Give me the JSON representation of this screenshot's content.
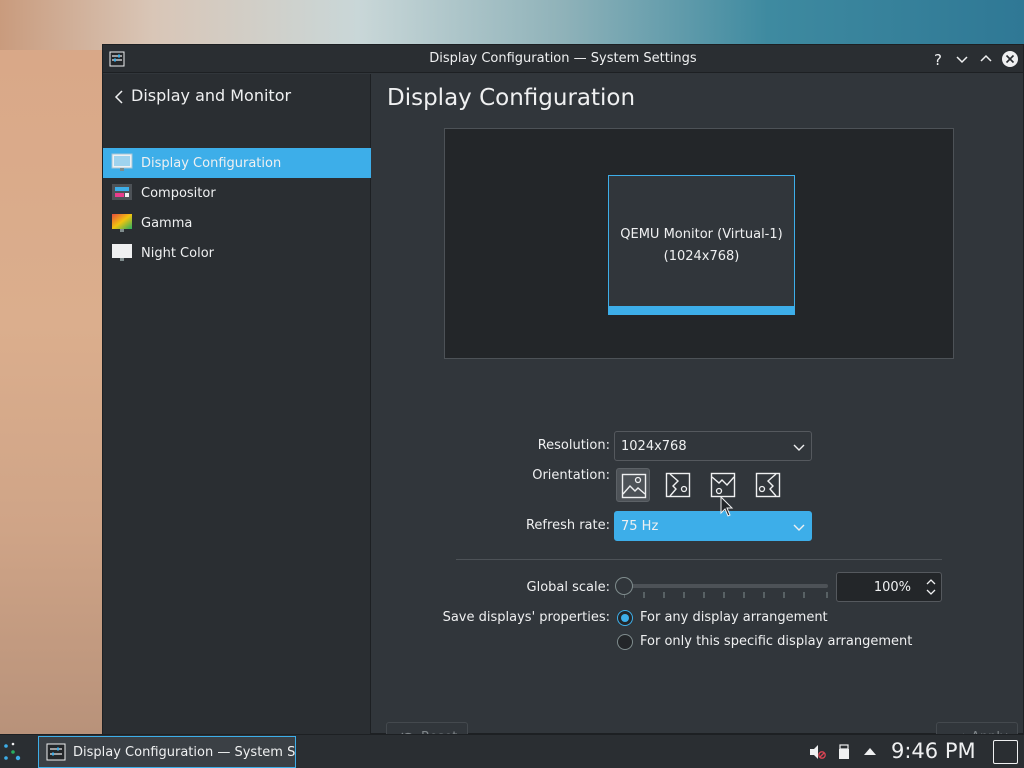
{
  "window": {
    "title": "Display Configuration — System Settings"
  },
  "sidebar": {
    "header": "Display and Monitor",
    "items": [
      {
        "label": "Display Configuration",
        "icon": "monitor-icon",
        "active": true
      },
      {
        "label": "Compositor",
        "icon": "compositor-icon",
        "active": false
      },
      {
        "label": "Gamma",
        "icon": "gamma-icon",
        "active": false
      },
      {
        "label": "Night Color",
        "icon": "night-color-icon",
        "active": false
      }
    ]
  },
  "main": {
    "title": "Display Configuration",
    "monitor": {
      "name": "QEMU Monitor (Virtual-1)",
      "resolution_label": "(1024x768)"
    },
    "resolution": {
      "label": "Resolution:",
      "value": "1024x768"
    },
    "orientation": {
      "label": "Orientation:",
      "options": [
        "landscape",
        "portrait-left",
        "inverted",
        "portrait-right"
      ],
      "selected": "landscape"
    },
    "refresh_rate": {
      "label": "Refresh rate:",
      "value": "75 Hz"
    },
    "global_scale": {
      "label": "Global scale:",
      "value": "100%",
      "slider_fraction": 0.0
    },
    "save_properties": {
      "label": "Save displays' properties:",
      "options": [
        {
          "label": "For any display arrangement",
          "checked": true
        },
        {
          "label": "For only this specific display arrangement",
          "checked": false
        }
      ]
    }
  },
  "footer": {
    "reset_label": "Reset",
    "apply_label": "Apply"
  },
  "taskbar": {
    "task_label": "Display Configuration  — System S...",
    "clock": "9:46 PM"
  },
  "colors": {
    "accent": "#3daee9",
    "window_bg": "#31363b",
    "sidebar_bg": "#2a2e32"
  }
}
